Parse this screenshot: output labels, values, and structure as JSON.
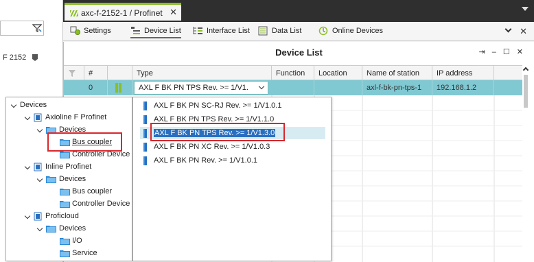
{
  "window": {
    "tab_title": "axc-f-2152-1 / Profinet"
  },
  "left_panel": {
    "device_label": "F 2152"
  },
  "toolbar": {
    "tabs": [
      {
        "label": "Settings",
        "icon": "settings-icon"
      },
      {
        "label": "Device List",
        "icon": "device-list-icon",
        "active": true
      },
      {
        "label": "Interface List",
        "icon": "interface-list-icon"
      },
      {
        "label": "Data List",
        "icon": "data-list-icon"
      },
      {
        "label": "Online Devices",
        "icon": "online-devices-icon"
      }
    ]
  },
  "device_list": {
    "title": "Device List",
    "columns": [
      "#",
      "",
      "Type",
      "Function",
      "Location",
      "Name of station",
      "IP address"
    ],
    "row": {
      "index": "0",
      "type": "AXL F BK PN TPS Rev. >= 1/V1.",
      "function": "",
      "location": "",
      "name_of_station": "axl-f-bk-pn-tps-1",
      "ip_address": "192.168.1.2"
    }
  },
  "tree": {
    "nodes": [
      {
        "label": "Devices",
        "level": 0,
        "expanded": true
      },
      {
        "label": "Axioline F Profinet",
        "level": 1,
        "expanded": true
      },
      {
        "label": "Devices",
        "level": 2,
        "expanded": true
      },
      {
        "label": "Bus coupler",
        "level": 3,
        "selected": true
      },
      {
        "label": "Controller Device",
        "level": 3
      },
      {
        "label": "Inline Profinet",
        "level": 1,
        "expanded": true
      },
      {
        "label": "Devices",
        "level": 2,
        "expanded": true
      },
      {
        "label": "Bus coupler",
        "level": 3
      },
      {
        "label": "Controller Device",
        "level": 3
      },
      {
        "label": "Proficloud",
        "level": 1,
        "expanded": true
      },
      {
        "label": "Devices",
        "level": 2,
        "expanded": true
      },
      {
        "label": "I/O",
        "level": 3
      },
      {
        "label": "Service",
        "level": 3
      }
    ]
  },
  "type_list": {
    "items": [
      {
        "label": "AXL F BK PN SC-RJ Rev. >= 1/V1.0.1"
      },
      {
        "label": "AXL F BK PN TPS Rev. >= 1/V1.1.0"
      },
      {
        "label": "AXL F BK PN TPS Rev. >= 1/V1.3.0",
        "selected": true
      },
      {
        "label": "AXL F BK PN XC Rev. >= 1/V1.0.3"
      },
      {
        "label": "AXL F BK PN Rev. >= 1/V1.0.1"
      }
    ]
  },
  "colors": {
    "accent": "#8cbf26",
    "row_highlight": "#80c8d2",
    "selection": "#2a6fbf",
    "callout": "#d9262b"
  }
}
